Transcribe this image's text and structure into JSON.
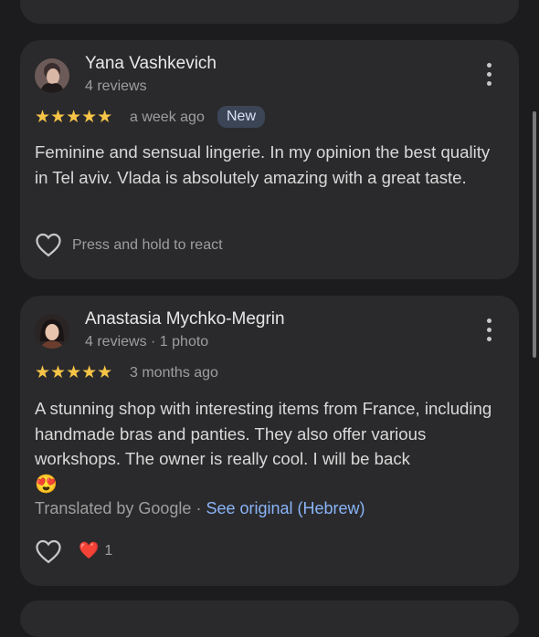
{
  "reviews": [
    {
      "name": "Yana Vashkevich",
      "meta": "4 reviews",
      "rating": 5,
      "stars": "★★★★★",
      "when": "a week ago",
      "badge": "New",
      "text": "Feminine and sensual lingerie. In my opinion the best quality in Tel aviv. Vlada is absolutely amazing with a great taste.",
      "react_label": "Press and hold to react"
    },
    {
      "name": "Anastasia Mychko-Megrin",
      "meta": "4 reviews · 1 photo",
      "rating": 5,
      "stars": "★★★★★",
      "when": "3 months ago",
      "text": "A stunning shop with interesting items from France, including handmade bras and panties. They also offer various workshops. The owner is really cool. I will be back",
      "emoji": "😍",
      "translated_by": "Translated by Google",
      "translated_sep": " · ",
      "see_original": "See original (Hebrew)",
      "reaction_emoji": "❤️",
      "reaction_count": "1"
    }
  ],
  "colors": {
    "star": "#f6c447",
    "link": "#8ab4f8",
    "card": "#2a2a2c",
    "background": "#1c1c1e"
  }
}
